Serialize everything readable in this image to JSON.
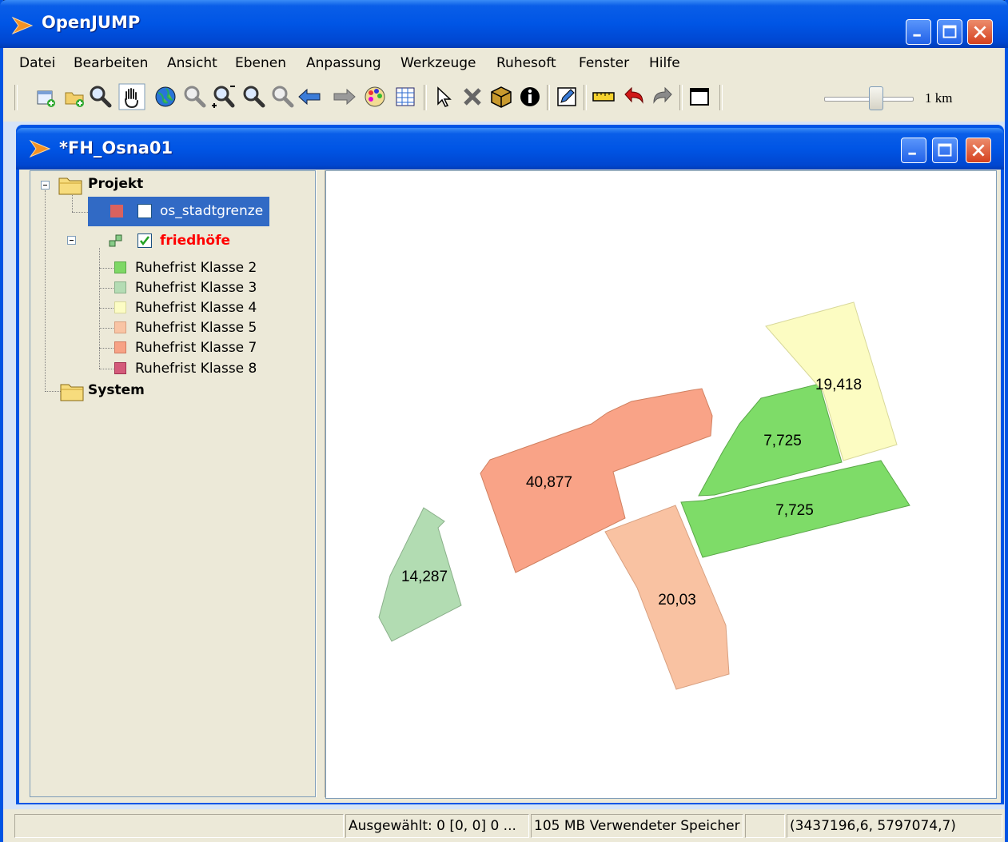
{
  "window": {
    "title": "OpenJUMP"
  },
  "menubar": {
    "items": [
      "Datei",
      "Bearbeiten",
      "Ansicht",
      "Ebenen",
      "Anpassung",
      "Werkzeuge",
      "Ruhesoft",
      "Fenster",
      "Hilfe"
    ]
  },
  "toolbar": {
    "buttons": [
      "new-task-icon",
      "add-layer-icon",
      "zoom-icon",
      "pan-hand-icon",
      "globe-icon",
      "zoom-to-selected-icon",
      "zoom-in-icon",
      "zoom-out-icon",
      "previous-view-icon",
      "next-view-icon",
      "color-palette-icon",
      "grid-table-icon",
      "select-arrow-icon",
      "delete-features-icon",
      "package-icon",
      "info-icon",
      "edit-pencil-icon",
      "ruler-icon",
      "undo-icon",
      "redo-icon",
      "frame-icon"
    ],
    "scale_label": "1 km",
    "scale_slider_value": 0.6
  },
  "inner_window": {
    "title": "*FH_Osna01"
  },
  "layer_tree": {
    "project_label": "Projekt",
    "system_label": "System",
    "layers": [
      {
        "name": "os_stadtgrenze",
        "swatch": "#d9625e",
        "checked": false,
        "selected": true
      },
      {
        "name": "friedhöfe",
        "checked": true,
        "color": "#ff0000"
      }
    ],
    "classes": [
      {
        "label": "Ruhefrist Klasse 2",
        "color": "#7ed865"
      },
      {
        "label": "Ruhefrist Klasse 3",
        "color": "#b4dcb4"
      },
      {
        "label": "Ruhefrist Klasse 4",
        "color": "#fcfcc4"
      },
      {
        "label": "Ruhefrist Klasse 5",
        "color": "#f9c4a4"
      },
      {
        "label": "Ruhefrist Klasse 7",
        "color": "#f7a285"
      },
      {
        "label": "Ruhefrist Klasse 8",
        "color": "#d45a7a"
      }
    ]
  },
  "map": {
    "labels": {
      "p1": "14,287",
      "p2": "40,877",
      "p3": "20,03",
      "p4": "7,725",
      "p5": "7,725",
      "p6": "19,418"
    },
    "colors": {
      "klasse2": "#7edc68",
      "klasse3": "#b2dcb2",
      "klasse4": "#fcfcc2",
      "klasse5": "#f9c2a2",
      "klasse7": "#f9a387"
    }
  },
  "statusbar": {
    "cell1": "",
    "selected": "Ausgewählt: 0 [0, 0] 0 ...",
    "memory": "105 MB Verwendeter Speicher",
    "cell4": "",
    "coords": "(3437196,6, 5797074,7)"
  }
}
